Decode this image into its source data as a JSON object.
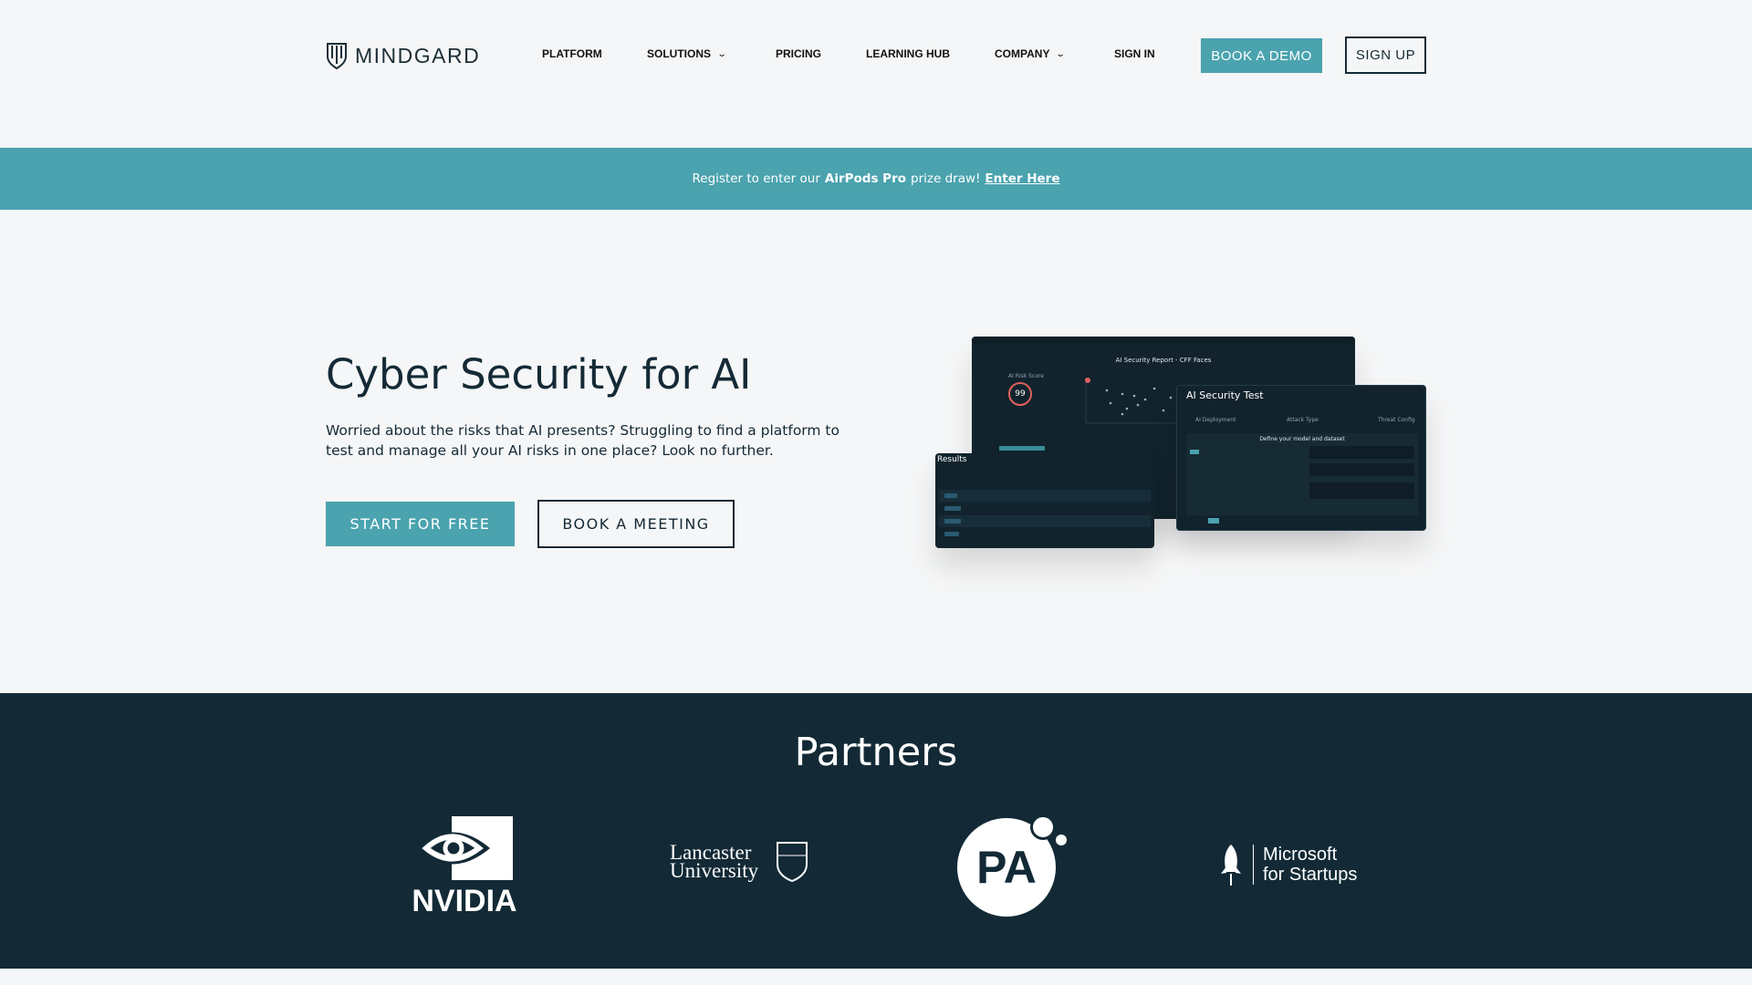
{
  "header": {
    "logo_text": "MINDGARD",
    "nav": [
      {
        "label": "PLATFORM",
        "dropdown": false
      },
      {
        "label": "SOLUTIONS",
        "dropdown": true
      },
      {
        "label": "PRICING",
        "dropdown": false
      },
      {
        "label": "LEARNING HUB",
        "dropdown": false
      },
      {
        "label": "COMPANY",
        "dropdown": true
      },
      {
        "label": "SIGN IN",
        "dropdown": false
      }
    ],
    "book_demo": "BOOK A DEMO",
    "sign_up": "SIGN UP"
  },
  "banner": {
    "prefix": "Register to enter our",
    "highlight": "AirPods Pro",
    "suffix": "prize draw!",
    "link": "Enter Here"
  },
  "hero": {
    "title": "Cyber Security for AI",
    "text": "Worried about the risks that AI presents? Struggling to find a platform to test and manage all your AI risks in one place? Look no further.",
    "start_button": "START FOR FREE",
    "meeting_button": "BOOK A MEETING",
    "screenshot": {
      "report_title": "AI Security Report - CFF Faces",
      "risk_score_label": "AI Risk Score",
      "risk_score": "99",
      "results_title": "Results",
      "test_title": "AI Security Test",
      "define_label": "Define your model and dataset",
      "steps": [
        "AI Deployment",
        "Attack Type",
        "Threat Config"
      ]
    }
  },
  "partners": {
    "title": "Partners",
    "logos": [
      "NVIDIA",
      "Lancaster University",
      "PA",
      "Microsoft for Startups"
    ]
  },
  "colors": {
    "accent": "#4aa3ae",
    "dark": "#132a36",
    "background": "#f5f6f7"
  }
}
